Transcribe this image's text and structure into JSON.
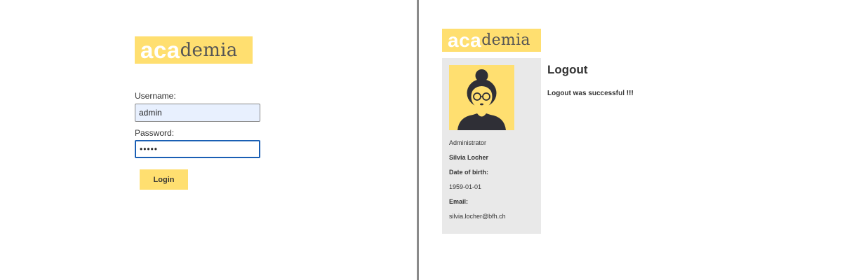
{
  "left_panel": {
    "logo": {
      "part1": "aca",
      "part2": "demia"
    },
    "username": {
      "label": "Username:",
      "value": "admin"
    },
    "password": {
      "label": "Password:",
      "value": "•••••"
    },
    "login_button": "Login"
  },
  "right_panel": {
    "logo": {
      "part1": "aca",
      "part2": "demia"
    },
    "profile": {
      "role": "Administrator",
      "name": "Silvia Locher",
      "dob_label": "Date of birth:",
      "dob": "1959-01-01",
      "email_label": "Email:",
      "email": "silvia.locher@bfh.ch"
    },
    "page_title": "Logout",
    "message": "Logout was successful !!!"
  },
  "colors": {
    "accent": "#ffdf70",
    "sidebar_bg": "#e9e9e9",
    "focus_border": "#1a5fb4",
    "autofill_bg": "#e8f0fe",
    "divider": "#8a8a8a"
  }
}
